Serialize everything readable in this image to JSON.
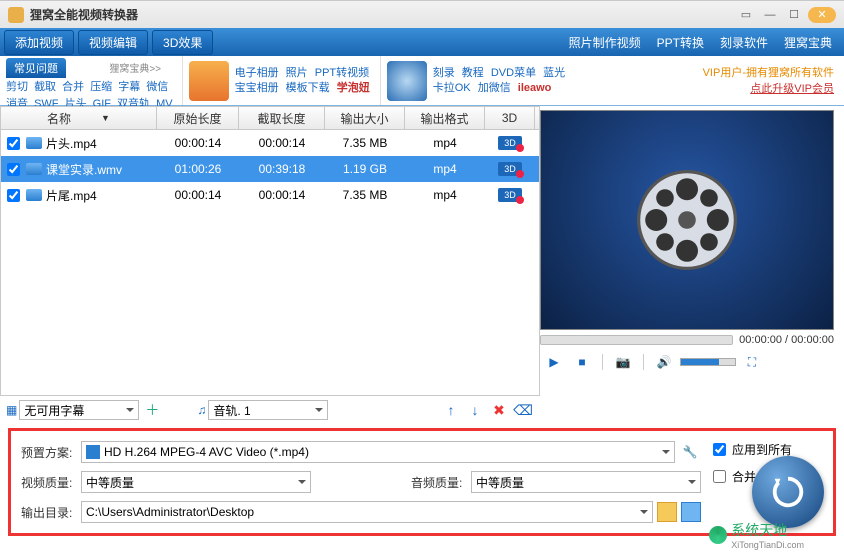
{
  "app": {
    "title": "狸窝全能视频转换器"
  },
  "window_buttons": {
    "menu": "▭",
    "min": "—",
    "max": "☐",
    "close": "✕"
  },
  "toolbar": {
    "add_video": "添加视频",
    "video_edit": "视频编辑",
    "effect_3d": "3D效果",
    "photo_video": "照片制作视频",
    "ppt_convert": "PPT转换",
    "burn_software": "刻录软件",
    "liwo_book": "狸窝宝典"
  },
  "faq": {
    "title": "常见问题",
    "meta": "狸窝宝典>>",
    "links_line1": [
      "剪切",
      "截取",
      "合并",
      "压缩",
      "字幕",
      "微信"
    ],
    "links_line2": [
      "消音",
      "SWF",
      "片头",
      "GIF",
      "双音轨",
      "MV"
    ]
  },
  "linkcol1": {
    "line1": [
      "电子相册",
      "照片",
      "PPT转视频"
    ],
    "line2_a": "宝宝相册",
    "line2_b": "模板下载",
    "line2_c": "学泡妞"
  },
  "linkcol2": {
    "line1": [
      "刻录",
      "教程",
      "DVD菜单",
      "蓝光"
    ],
    "line2_a": "卡拉OK",
    "line2_b": "加微信",
    "line2_c": "ileawo"
  },
  "vip": {
    "line1": "VIP用户-拥有狸窝所有软件",
    "line2": "点此升级VIP会员"
  },
  "table": {
    "headers": {
      "name": "名称",
      "orig": "原始长度",
      "cut": "截取长度",
      "size": "输出大小",
      "fmt": "输出格式",
      "three_d": "3D"
    },
    "rows": [
      {
        "checked": true,
        "name": "片头.mp4",
        "orig": "00:00:14",
        "cut": "00:00:14",
        "size": "7.35 MB",
        "fmt": "mp4",
        "selected": false
      },
      {
        "checked": true,
        "name": "课堂实录.wmv",
        "orig": "01:00:26",
        "cut": "00:39:18",
        "size": "1.19 GB",
        "fmt": "mp4",
        "selected": true
      },
      {
        "checked": true,
        "name": "片尾.mp4",
        "orig": "00:00:14",
        "cut": "00:00:14",
        "size": "7.35 MB",
        "fmt": "mp4",
        "selected": false
      }
    ]
  },
  "subtitle_select": "无可用字幕",
  "audio_track_select": "音轨. 1",
  "time": {
    "current": "00:00:00",
    "total": "00:00:00"
  },
  "settings": {
    "preset_label": "预置方案:",
    "preset_value": "HD H.264 MPEG-4 AVC Video (*.mp4)",
    "video_quality_label": "视频质量:",
    "video_quality_value": "中等质量",
    "audio_quality_label": "音频质量:",
    "audio_quality_value": "中等质量",
    "output_dir_label": "输出目录:",
    "output_dir_value": "C:\\Users\\Administrator\\Desktop",
    "apply_all": "应用到所有",
    "merge_one": "合并成一个文件"
  },
  "watermark": {
    "name": "系统天地",
    "url": "XiTongTianDi.com"
  }
}
